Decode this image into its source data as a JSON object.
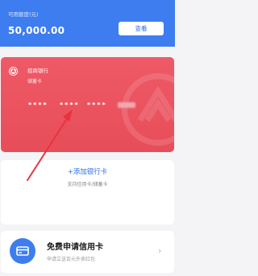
{
  "credit": {
    "label": "可用额度(元)",
    "amount": "50,000.00",
    "view_button": "查看"
  },
  "bank_card": {
    "bank_name": "招商银行",
    "card_type": "储蓄卡",
    "masked_groups": [
      "****",
      "****",
      "****"
    ]
  },
  "add_card": {
    "label": "+添加银行卡",
    "hint": "支持信用卡/储蓄卡"
  },
  "promo": {
    "title": "免费申请信用卡",
    "subtitle": "申请立送百元外卖红包",
    "chevron": "›"
  },
  "colors": {
    "header_blue": "#3d7df0",
    "card_red": "#e74d58",
    "link_blue": "#2f6fe4",
    "arrow_red": "#e8333c"
  }
}
